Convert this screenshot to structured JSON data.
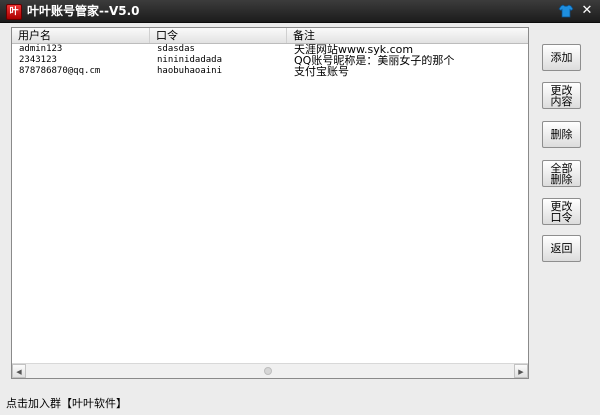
{
  "window": {
    "title": "叶叶账号管家--V5.0",
    "app_icon_text": "叶"
  },
  "table": {
    "headers": [
      "用户名",
      "口令",
      "备注"
    ],
    "rows": [
      [
        "admin123",
        "sdasdas",
        "天涯网站www.syk.com"
      ],
      [
        "2343123",
        "nininidadada",
        "QQ账号昵称是：美丽女子的那个"
      ],
      [
        "878786870@qq.cm",
        "haobuhaoaini",
        "支付宝账号"
      ]
    ]
  },
  "buttons": {
    "add": "添加",
    "edit_content": "更改\n内容",
    "delete": "删除",
    "delete_all": "全部\n删除",
    "change_password": "更改\n口令",
    "back": "返回"
  },
  "statusbar": {
    "text": "点击加入群【叶叶软件】"
  },
  "colors": {
    "titlebar": "#2a2a2a",
    "window_bg": "#ececec",
    "skin_icon": "#1e8fe0"
  }
}
